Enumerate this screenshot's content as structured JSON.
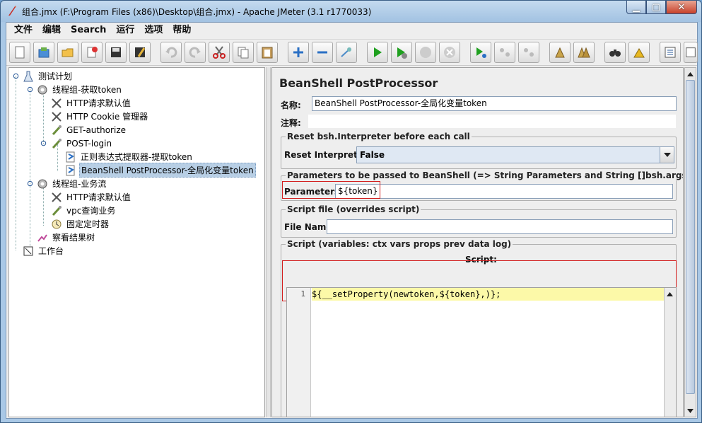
{
  "window": {
    "title": "组合.jmx (F:\\Program Files (x86)\\Desktop\\组合.jmx) - Apache JMeter (3.1 r1770033)"
  },
  "menu": [
    "文件",
    "编辑",
    "Search",
    "运行",
    "选项",
    "帮助"
  ],
  "toolbar": {
    "icons": [
      "new-icon",
      "templates-icon",
      "open-icon",
      "close-icon",
      "save-icon",
      "save-as-icon",
      "undo-icon",
      "redo-icon",
      "cut-icon",
      "copy-icon",
      "paste-icon",
      "expand-icon",
      "collapse-icon",
      "toggle-icon",
      "start-icon",
      "start-no-pause-icon",
      "stop-icon",
      "shutdown-icon",
      "remote-start-icon",
      "remote-stop-icon",
      "remote-shutdown-icon",
      "clear-icon",
      "clear-all-icon",
      "search-icon",
      "reset-search-icon",
      "function-helper-icon",
      "help-icon"
    ]
  },
  "tree": [
    {
      "label": "测试计划",
      "icon": "test-plan-icon"
    },
    {
      "label": "线程组-获取token",
      "icon": "thread-group-icon"
    },
    {
      "label": "HTTP请求默认值",
      "icon": "config-icon"
    },
    {
      "label": "HTTP Cookie 管理器",
      "icon": "config-icon"
    },
    {
      "label": "GET-authorize",
      "icon": "sampler-icon"
    },
    {
      "label": "POST-login",
      "icon": "sampler-icon"
    },
    {
      "label": "正则表达式提取器-提取token",
      "icon": "postprocessor-icon"
    },
    {
      "label": "BeanShell PostProcessor-全局化变量token",
      "icon": "postprocessor-icon"
    },
    {
      "label": "线程组-业务流",
      "icon": "thread-group-icon"
    },
    {
      "label": "HTTP请求默认值",
      "icon": "config-icon"
    },
    {
      "label": "vpc查询业务",
      "icon": "sampler-icon"
    },
    {
      "label": "固定定时器",
      "icon": "timer-icon"
    },
    {
      "label": "察看结果树",
      "icon": "listener-icon"
    },
    {
      "label": "工作台",
      "icon": "workbench-icon"
    }
  ],
  "panel": {
    "title": "BeanShell PostProcessor",
    "name_label": "名称:",
    "name_value": "BeanShell PostProcessor-全局化变量token",
    "comment_label": "注释:",
    "comment_value": "",
    "reset_group_title": "Reset bsh.Interpreter before each call",
    "reset_label": "Reset Interpreter:",
    "reset_value": "False",
    "params_group_title": "Parameters to be passed to BeanShell (=> String Parameters and String []bsh.args)",
    "params_label": "Parameters:",
    "params_value": "${token}",
    "file_group_title": "Script file (overrides script)",
    "file_label": "File Name:",
    "file_value": "",
    "script_group_title": "Script (variables: ctx vars props prev data log)",
    "script_label": "Script:",
    "line_number": "1",
    "code": "${__setProperty(newtoken,${token},)};"
  }
}
